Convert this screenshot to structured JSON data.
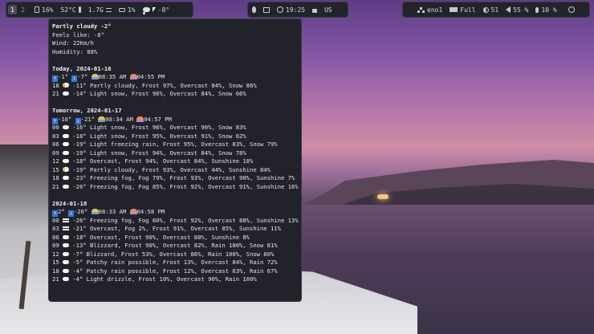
{
  "topbar": {
    "left": {
      "workspaces": [
        {
          "label": "1",
          "active": true
        },
        {
          "label": "2",
          "active": false
        }
      ],
      "cpu": "16%",
      "temp": "52°C",
      "memory": "1.7G",
      "disk": "1%",
      "weather": "-8°"
    },
    "center": {
      "time": "19:25",
      "layout": "US"
    },
    "right": {
      "network": "eno1",
      "battery": "Full",
      "brightness": "51",
      "volume": "55 %",
      "mic": "10 %"
    }
  },
  "weather": {
    "summary": "Partly cloudy -2°",
    "feels_like": "Feels like: -8°",
    "wind": "Wind: 22Km/h",
    "humidity": "Humidity: 88%",
    "days": [
      {
        "title": "Today, 2024-01-16",
        "hi": "-1°",
        "lo": "-7°",
        "sunrise": "08:35 AM",
        "sunset": "04:55 PM",
        "rows": [
          {
            "hour": "18",
            "icon": "partly",
            "text": "-11° Partly cloudy, Frost 97%, Overcast 84%, Snow 86%"
          },
          {
            "hour": "21",
            "icon": "cloud",
            "text": "-14° Light snow, Frost 96%, Overcast 84%, Snow 66%"
          }
        ]
      },
      {
        "title": "Tomorrow, 2024-01-17",
        "hi": "-10°",
        "lo": "-21°",
        "sunrise": "08:34 AM",
        "sunset": "04:57 PM",
        "rows": [
          {
            "hour": "00",
            "icon": "cloud",
            "text": "-16° Light snow, Frost 96%, Overcast 90%, Snow 83%"
          },
          {
            "hour": "03",
            "icon": "cloud",
            "text": "-18° Light snow, Frost 95%, Overcast 91%, Snow 62%"
          },
          {
            "hour": "06",
            "icon": "cloud",
            "text": "-19° Light freezing rain, Frost 95%, Overcast 83%, Snow 79%"
          },
          {
            "hour": "09",
            "icon": "cloud",
            "text": "-19° Light snow, Frost 94%, Overcast 84%, Snow 78%"
          },
          {
            "hour": "12",
            "icon": "cloud",
            "text": "-18° Overcast, Frost 94%, Overcast 84%, Sunshine 18%"
          },
          {
            "hour": "15",
            "icon": "partly",
            "text": "-19° Partly cloudy, Frost 93%, Overcast 44%, Sunshine 84%"
          },
          {
            "hour": "18",
            "icon": "cloud",
            "text": "-23° Freezing fog, Fog 79%, Frost 93%, Overcast 90%, Sunshine 7%"
          },
          {
            "hour": "21",
            "icon": "cloud",
            "text": "-26° Freezing fog, Fog 85%, Frost 92%, Overcast 91%, Sunshine 16%"
          }
        ]
      },
      {
        "title": "2024-01-18",
        "hi": "2°",
        "lo": "-20°",
        "sunrise": "08:33 AM",
        "sunset": "04:58 PM",
        "rows": [
          {
            "hour": "00",
            "icon": "fog",
            "text": "-26° Freezing fog, Fog 60%, Frost 92%, Overcast 88%, Sunshine 13%"
          },
          {
            "hour": "03",
            "icon": "fog",
            "text": "-21° Overcast, Fog 2%, Frost 91%, Overcast 85%, Sunshine 11%"
          },
          {
            "hour": "06",
            "icon": "cloud",
            "text": "-18° Overcast, Frost 90%, Overcast 88%, Sunshine 8%"
          },
          {
            "hour": "09",
            "icon": "cloud",
            "text": "-13° Blizzard, Frost 90%, Overcast 82%, Rain 100%, Snow 81%"
          },
          {
            "hour": "12",
            "icon": "cloud",
            "text": "-7° Blizzard, Frost 53%, Overcast 86%, Rain 100%, Snow 80%"
          },
          {
            "hour": "15",
            "icon": "cloud",
            "text": "-5° Patchy rain possible, Frost 13%, Overcast 84%, Rain 72%"
          },
          {
            "hour": "18",
            "icon": "cloud",
            "text": "-4° Patchy rain possible, Frost 12%, Overcast 63%, Rain 67%"
          },
          {
            "hour": "21",
            "icon": "cloud",
            "text": "-4° Light drizzle, Frost 10%, Overcast 90%, Rain 100%"
          }
        ]
      }
    ]
  }
}
